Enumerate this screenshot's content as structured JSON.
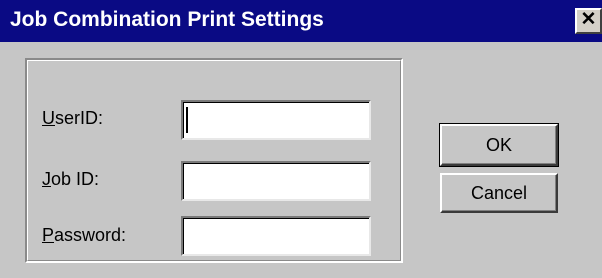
{
  "window": {
    "title": "Job Combination Print Settings",
    "close_glyph": "✕"
  },
  "form": {
    "userid": {
      "label_mnemonic": "U",
      "label_rest": "serID:",
      "value": ""
    },
    "jobid": {
      "label_mnemonic": "J",
      "label_rest": "ob ID:",
      "value": ""
    },
    "password": {
      "label_mnemonic": "P",
      "label_rest": "assword:",
      "value": ""
    }
  },
  "buttons": {
    "ok_label": "OK",
    "cancel_label": "Cancel"
  },
  "colors": {
    "titlebar": "#0a0a84",
    "dialog_face": "#c6c6c6",
    "field_bg": "#ffffff"
  }
}
